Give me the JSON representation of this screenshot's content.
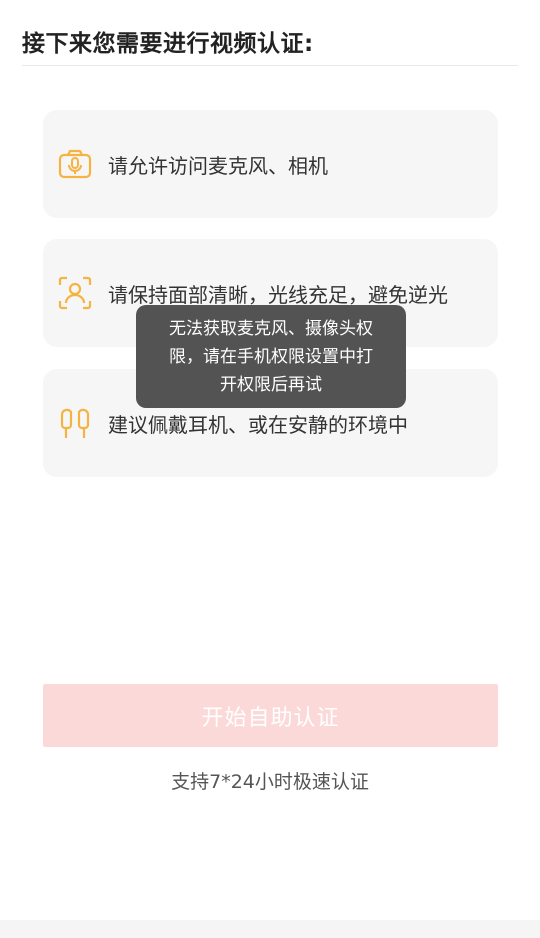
{
  "header": {
    "title": "接下来您需要进行视频认证:"
  },
  "requirements": [
    {
      "icon": "camera-mic-icon",
      "label": "请允许访问麦克风、相机"
    },
    {
      "icon": "face-scan-icon",
      "label": "请保持面部清晰，光线充足，避免逆光"
    },
    {
      "icon": "earphones-icon",
      "label": "建议佩戴耳机、或在安静的环境中"
    }
  ],
  "toast": {
    "lines": [
      "无法获取麦克风、摄像头权",
      "限，请在手机权限设置中打",
      "开权限后再试"
    ]
  },
  "start_button": {
    "label": "开始自助认证",
    "state": "disabled"
  },
  "support_text": "支持7*24小时极速认证",
  "colors": {
    "accent_icon": "#f5b342",
    "button_disabled_bg": "#fcd9d9",
    "card_bg": "#f6f6f6",
    "toast_bg": "#464646"
  }
}
